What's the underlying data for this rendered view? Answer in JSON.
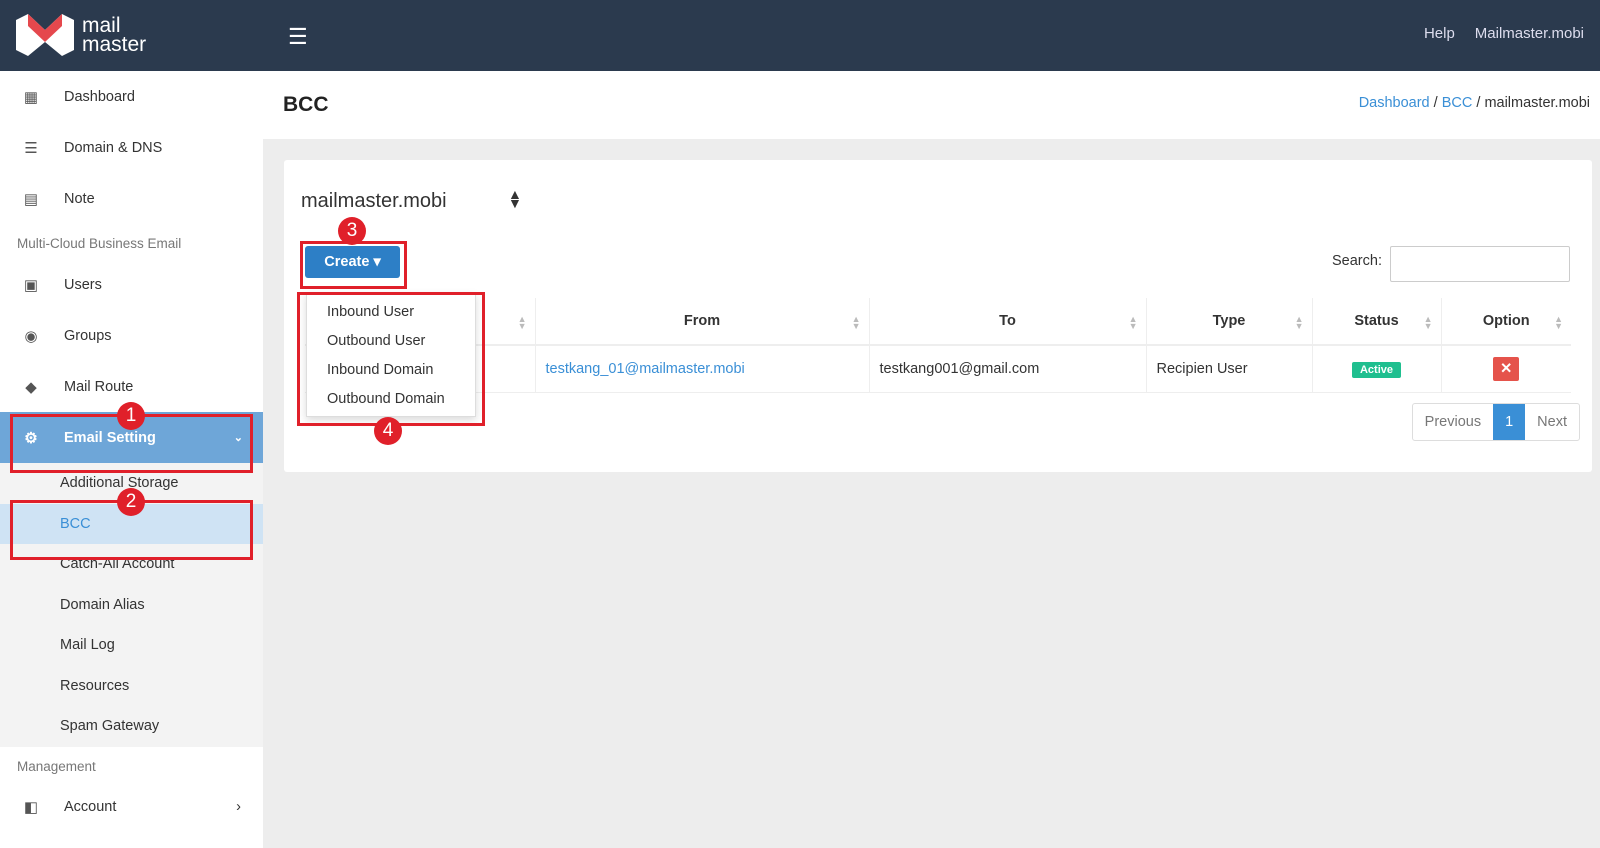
{
  "brand": {
    "line1": "mail",
    "line2": "master"
  },
  "topbar": {
    "help": "Help",
    "account": "Mailmaster.mobi"
  },
  "sidebar": {
    "items": [
      {
        "label": "Dashboard",
        "icon": "dashboard-icon"
      },
      {
        "label": "Domain & DNS",
        "icon": "server-icon"
      },
      {
        "label": "Note",
        "icon": "calendar-icon"
      }
    ],
    "section1": "Multi-Cloud Business Email",
    "items2": [
      {
        "label": "Users",
        "icon": "user-card-icon"
      },
      {
        "label": "Groups",
        "icon": "groups-icon"
      },
      {
        "label": "Mail Route",
        "icon": "route-icon"
      },
      {
        "label": "Email Setting",
        "icon": "gear-icon"
      }
    ],
    "subitems": [
      "Additional Storage",
      "BCC",
      "Catch-All Account",
      "Domain Alias",
      "Mail Log",
      "Resources",
      "Spam Gateway"
    ],
    "section2": "Management",
    "account": "Account"
  },
  "page": {
    "title": "BCC",
    "breadcrumb": [
      "Dashboard",
      "BCC",
      "mailmaster.mobi"
    ]
  },
  "domain_select": "mailmaster.mobi",
  "create_label": "Create",
  "create_menu": [
    "Inbound User",
    "Outbound User",
    "Inbound Domain",
    "Outbound Domain"
  ],
  "search_label": "Search:",
  "table": {
    "headers": [
      "",
      "From",
      "To",
      "Type",
      "Status",
      "Option"
    ],
    "rows": [
      {
        "from": "testkang_01@mailmaster.mobi",
        "to": "testkang001@gmail.com",
        "type": "Recipien User",
        "status": "Active"
      }
    ]
  },
  "pager": {
    "prev": "Previous",
    "page": "1",
    "next": "Next"
  },
  "annotations": [
    "1",
    "2",
    "3",
    "4"
  ],
  "colors": {
    "accent": "#2d7fc6",
    "topbar": "#2b3a4e",
    "highlight": "#e0202a",
    "active": "#1fbf8f"
  }
}
